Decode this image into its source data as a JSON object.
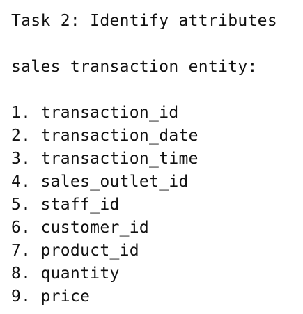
{
  "document": {
    "task_title": "Task 2: Identify attributes",
    "entity_heading": "sales transaction entity:",
    "attributes": [
      "1. transaction_id",
      "2. transaction_date",
      "3. transaction_time",
      "4. sales_outlet_id",
      "5. staff_id",
      "6. customer_id",
      "7. product_id",
      "8. quantity",
      "9. price"
    ]
  }
}
